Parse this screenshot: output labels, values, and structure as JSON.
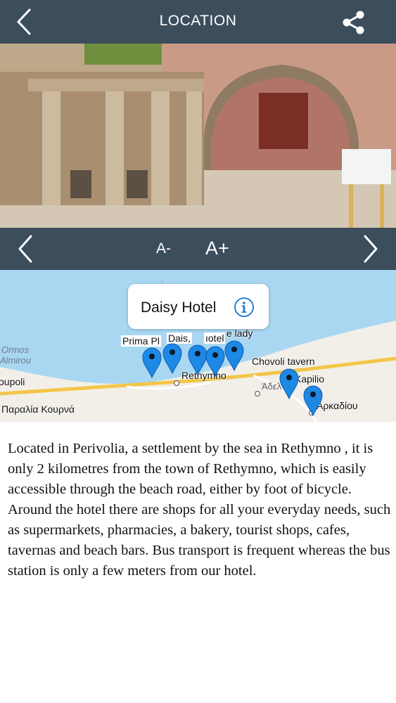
{
  "header": {
    "title": "LOCATION",
    "back_icon": "chevron-left-icon",
    "share_icon": "share-icon",
    "background": "#3c4d5c"
  },
  "gallery": {
    "page_count": 3,
    "active_index": 0
  },
  "controls": {
    "decrease_font": "A-",
    "increase_font": "A+",
    "prev_icon": "chevron-left-icon",
    "next_icon": "chevron-right-icon"
  },
  "map": {
    "callout": {
      "title": "Daisy Hotel",
      "info_icon": "info-icon"
    },
    "labels": {
      "ormos": "Ormos",
      "almirou": "Almirou",
      "oupoli": "oupoli",
      "paralia": "Παραλία Κουρνά",
      "prima": "Prima Pl",
      "daisy": "Dais,",
      "hotel": "ıotel",
      "lady": "e lady",
      "chovoli": "Chovoli tavern",
      "rethymno": "Rethymno",
      "adele": "Άδελ",
      "kapilio": "Kapilio",
      "arkadiou": "Αρκαδίου"
    },
    "pin_color": "#1e88e5",
    "water_color": "#a9d7f2",
    "land_color": "#f2efe9"
  },
  "description": "Located in Perivolia, a settlement by the sea in Rethymno , it is only 2 kilometres from the town of Rethymno, which is easily accessible through the beach road, either by foot of bicycle. Around the hotel there are shops for all your everyday needs, such as supermarkets, pharmacies, a bakery, tourist shops, cafes, tavernas and beach bars. Bus transport is frequent whereas the bus station is only a few meters from our hotel."
}
